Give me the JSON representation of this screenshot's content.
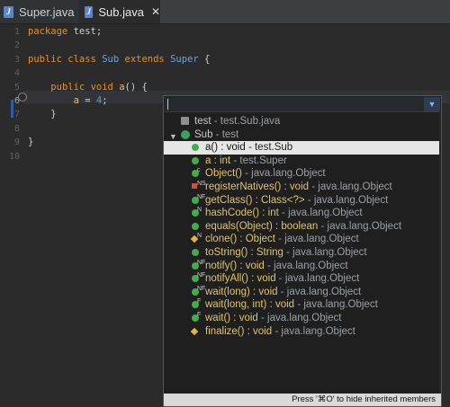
{
  "tabs": [
    {
      "label": "Super.java",
      "active": false
    },
    {
      "label": "Sub.java",
      "active": true,
      "close": "✕"
    }
  ],
  "editor": {
    "line_numbers": [
      "1",
      "2",
      "3",
      "4",
      "5",
      "6",
      "7",
      "8",
      "9",
      "10"
    ],
    "active_line": "6",
    "lines": [
      {
        "parts": [
          {
            "c": "kw",
            "t": "package"
          },
          {
            "c": "",
            "t": " test;"
          }
        ]
      },
      {
        "parts": []
      },
      {
        "parts": [
          {
            "c": "kw",
            "t": "public"
          },
          {
            "c": "",
            "t": " "
          },
          {
            "c": "kw",
            "t": "class"
          },
          {
            "c": "",
            "t": " "
          },
          {
            "c": "id",
            "t": "Sub"
          },
          {
            "c": "",
            "t": " "
          },
          {
            "c": "kw",
            "t": "extends"
          },
          {
            "c": "",
            "t": " "
          },
          {
            "c": "id",
            "t": "Super"
          },
          {
            "c": "",
            "t": " {"
          }
        ]
      },
      {
        "parts": []
      },
      {
        "parts": [
          {
            "c": "",
            "t": "    "
          },
          {
            "c": "kw",
            "t": "public"
          },
          {
            "c": "",
            "t": " "
          },
          {
            "c": "kw",
            "t": "void"
          },
          {
            "c": "",
            "t": " "
          },
          {
            "c": "fn",
            "t": "a"
          },
          {
            "c": "",
            "t": "() {"
          }
        ]
      },
      {
        "parts": [
          {
            "c": "",
            "t": "        "
          },
          {
            "c": "fn",
            "t": "a"
          },
          {
            "c": "",
            "t": " = "
          },
          {
            "c": "num",
            "t": "4"
          },
          {
            "c": "",
            "t": ";"
          }
        ]
      },
      {
        "parts": [
          {
            "c": "",
            "t": "    }"
          }
        ]
      },
      {
        "parts": []
      },
      {
        "parts": [
          {
            "c": "",
            "t": "}"
          }
        ]
      },
      {
        "parts": []
      }
    ]
  },
  "popup": {
    "input_value": "",
    "status": "Press '⌘O' to hide inherited members",
    "rows": [
      {
        "icon": "pkg",
        "indent": false,
        "name": "test",
        "sep": " - ",
        "type": "test.Sub.java",
        "selected": false
      },
      {
        "icon": "cls",
        "indent": false,
        "tree": "▼",
        "name": "Sub",
        "sep": " - ",
        "type": "test",
        "selected": false
      },
      {
        "icon": "green",
        "indent": true,
        "name": "a() : void",
        "sep": " - ",
        "type": "test.Sub",
        "selected": true
      },
      {
        "icon": "green",
        "indent": true,
        "name": "a : int",
        "sep": " - ",
        "type": "test.Super",
        "selected": false
      },
      {
        "icon": "green",
        "indent": true,
        "sup": "c",
        "name": "Object()",
        "sep": " - ",
        "type": "java.lang.Object",
        "selected": false
      },
      {
        "icon": "red",
        "indent": true,
        "sup": "NS",
        "name": "registerNatives() : void",
        "sep": " - ",
        "type": "java.lang.Object",
        "selected": false
      },
      {
        "icon": "green",
        "indent": true,
        "sup": "NF",
        "name": "getClass() : Class<?>",
        "sep": " - ",
        "type": "java.lang.Object",
        "selected": false
      },
      {
        "icon": "green",
        "indent": true,
        "sup": "N",
        "name": "hashCode() : int",
        "sep": " - ",
        "type": "java.lang.Object",
        "selected": false
      },
      {
        "icon": "green",
        "indent": true,
        "name": "equals(Object) : boolean",
        "sep": " - ",
        "type": "java.lang.Object",
        "selected": false
      },
      {
        "icon": "diamond",
        "indent": true,
        "sup": "N",
        "name": "clone() : Object",
        "sep": " - ",
        "type": "java.lang.Object",
        "selected": false
      },
      {
        "icon": "green",
        "indent": true,
        "name": "toString() : String",
        "sep": " - ",
        "type": "java.lang.Object",
        "selected": false
      },
      {
        "icon": "green",
        "indent": true,
        "sup": "NF",
        "name": "notify() : void",
        "sep": " - ",
        "type": "java.lang.Object",
        "selected": false
      },
      {
        "icon": "green",
        "indent": true,
        "sup": "NF",
        "name": "notifyAll() : void",
        "sep": " - ",
        "type": "java.lang.Object",
        "selected": false
      },
      {
        "icon": "green",
        "indent": true,
        "sup": "NF",
        "name": "wait(long) : void",
        "sep": " - ",
        "type": "java.lang.Object",
        "selected": false
      },
      {
        "icon": "green",
        "indent": true,
        "sup": "F",
        "name": "wait(long, int) : void",
        "sep": " - ",
        "type": "java.lang.Object",
        "selected": false
      },
      {
        "icon": "green",
        "indent": true,
        "sup": "F",
        "name": "wait() : void",
        "sep": " - ",
        "type": "java.lang.Object",
        "selected": false
      },
      {
        "icon": "diamond",
        "indent": true,
        "name": "finalize() : void",
        "sep": " - ",
        "type": "java.lang.Object",
        "selected": false
      }
    ]
  }
}
